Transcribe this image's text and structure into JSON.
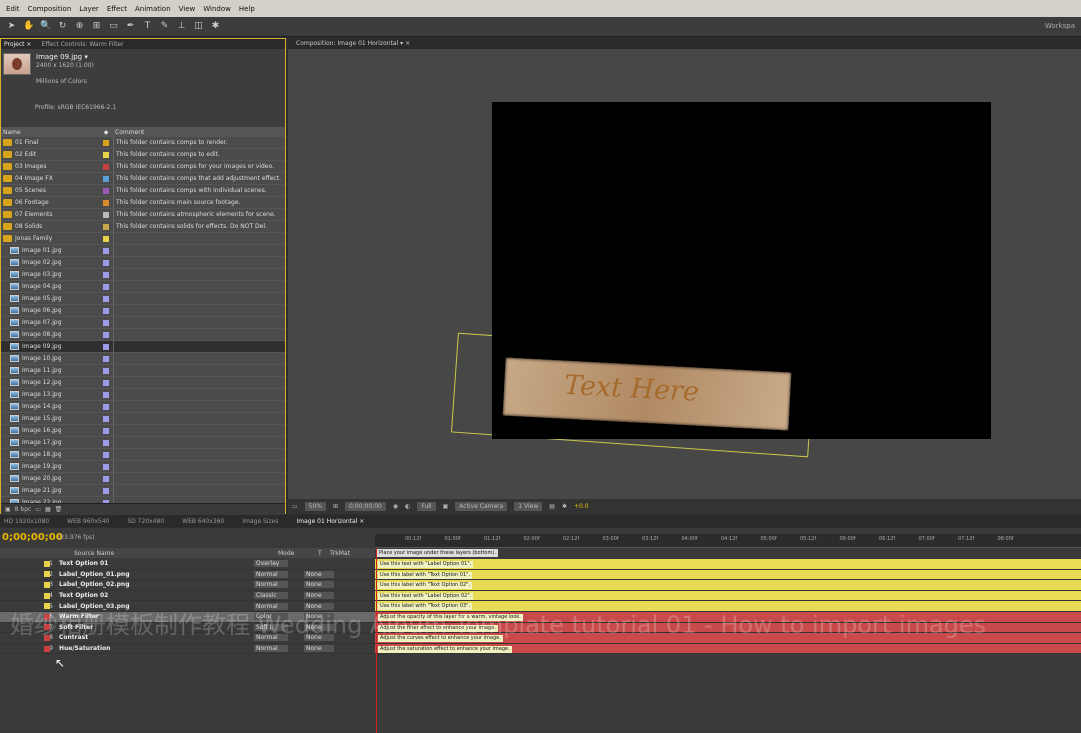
{
  "menu": [
    "Edit",
    "Composition",
    "Layer",
    "Effect",
    "Animation",
    "View",
    "Window",
    "Help"
  ],
  "workspace_label": "Workspa",
  "project": {
    "tabs": [
      "Project ×",
      "Effect Controls: Warm Filter"
    ],
    "selected_name": "Image 09.jpg ▾",
    "dims": "2400 x 1620 (1.00)",
    "colors": "Millions of Colors",
    "profile": "Profile: sRGB IEC61966-2.1",
    "header_name": "Name",
    "header_comment": "Comment",
    "rows": [
      {
        "name": "01 Final",
        "type": "folder",
        "color": "#d9a31c",
        "comment": "This folder contains comps to render."
      },
      {
        "name": "02 Edit",
        "type": "folder",
        "color": "#e7d34a",
        "comment": "This folder contains comps to edit."
      },
      {
        "name": "03 Images",
        "type": "folder",
        "color": "#c94040",
        "comment": "This folder contains comps for your images or video."
      },
      {
        "name": "04 Image FX",
        "type": "folder",
        "color": "#5aa0d8",
        "comment": "This folder contains comps that add adjustment effect."
      },
      {
        "name": "05 Scenes",
        "type": "folder",
        "color": "#9a5ab3",
        "comment": "This folder contains comps with individual scenes."
      },
      {
        "name": "06 Footage",
        "type": "folder",
        "color": "#d98c2a",
        "comment": "This folder contains main source footage."
      },
      {
        "name": "07 Elements",
        "type": "folder",
        "color": "#b8b8b8",
        "comment": "This folder contains atmospheric elements for scene."
      },
      {
        "name": "08 Solids",
        "type": "folder",
        "color": "#c9a64a",
        "comment": "This folder contains solids for effects. Do NOT Del."
      },
      {
        "name": "Jonas Family",
        "type": "folder",
        "color": "#e7d34a",
        "comment": ""
      },
      {
        "name": "Image 01.jpg",
        "type": "image",
        "color": "#9b9be8",
        "comment": ""
      },
      {
        "name": "Image 02.jpg",
        "type": "image",
        "color": "#9b9be8",
        "comment": ""
      },
      {
        "name": "Image 03.jpg",
        "type": "image",
        "color": "#9b9be8",
        "comment": ""
      },
      {
        "name": "Image 04.jpg",
        "type": "image",
        "color": "#9b9be8",
        "comment": ""
      },
      {
        "name": "Image 05.jpg",
        "type": "image",
        "color": "#9b9be8",
        "comment": ""
      },
      {
        "name": "Image 06.jpg",
        "type": "image",
        "color": "#9b9be8",
        "comment": ""
      },
      {
        "name": "Image 07.jpg",
        "type": "image",
        "color": "#9b9be8",
        "comment": ""
      },
      {
        "name": "Image 08.jpg",
        "type": "image",
        "color": "#9b9be8",
        "comment": ""
      },
      {
        "name": "Image 09.jpg",
        "type": "image",
        "color": "#9b9be8",
        "comment": "",
        "selected": true
      },
      {
        "name": "Image 10.jpg",
        "type": "image",
        "color": "#9b9be8",
        "comment": ""
      },
      {
        "name": "Image 11.jpg",
        "type": "image",
        "color": "#9b9be8",
        "comment": ""
      },
      {
        "name": "Image 12.jpg",
        "type": "image",
        "color": "#9b9be8",
        "comment": ""
      },
      {
        "name": "Image 13.jpg",
        "type": "image",
        "color": "#9b9be8",
        "comment": ""
      },
      {
        "name": "Image 14.jpg",
        "type": "image",
        "color": "#9b9be8",
        "comment": ""
      },
      {
        "name": "Image 15.jpg",
        "type": "image",
        "color": "#9b9be8",
        "comment": ""
      },
      {
        "name": "Image 16.jpg",
        "type": "image",
        "color": "#9b9be8",
        "comment": ""
      },
      {
        "name": "Image 17.jpg",
        "type": "image",
        "color": "#9b9be8",
        "comment": ""
      },
      {
        "name": "Image 18.jpg",
        "type": "image",
        "color": "#9b9be8",
        "comment": ""
      },
      {
        "name": "Image 19.jpg",
        "type": "image",
        "color": "#9b9be8",
        "comment": ""
      },
      {
        "name": "Image 20.jpg",
        "type": "image",
        "color": "#9b9be8",
        "comment": ""
      },
      {
        "name": "Image 21.jpg",
        "type": "image",
        "color": "#9b9be8",
        "comment": ""
      },
      {
        "name": "Image 22.jpg",
        "type": "image",
        "color": "#9b9be8",
        "comment": ""
      }
    ],
    "bpc": "8 bpc"
  },
  "composition": {
    "tab": "Composition: Image 01 Horizontal ▾ ×",
    "text_here": "Text Here",
    "bar": {
      "zoom": "50%",
      "timecode": "0;00;00;00",
      "resolution": "Full",
      "camera": "Active Camera",
      "views": "1 View",
      "exposure": "+0.0"
    }
  },
  "timeline_tabs": [
    "HD 1920x1080",
    "WEB 960x540",
    "SD 720x480",
    "WEB 640x360",
    "Image Sizes",
    "Image 01 Horizontal ×"
  ],
  "timeline": {
    "timecode": "0;00;00;00",
    "fps": "(23.976 fps)",
    "ruler": [
      "00:12f",
      "01:00f",
      "01:12f",
      "02:00f",
      "02:12f",
      "03:00f",
      "03:12f",
      "04:00f",
      "04:12f",
      "05:00f",
      "05:12f",
      "06:00f",
      "06:12f",
      "07:00f",
      "07:12f",
      "08:00f"
    ],
    "col_source": "Source Name",
    "col_mode": "Mode",
    "col_t": "T",
    "col_trkmat": "TrkMat",
    "comment_top": "Place your image under these layers (bottom).",
    "layers": [
      {
        "num": "1",
        "name": "Text Option 01",
        "mode": "Overlay",
        "trk": "",
        "color": "#e7d34a",
        "bar": "#e8dc54",
        "label": "Use this text with \"Label Option 01\"."
      },
      {
        "num": "2",
        "name": "Label_Option_01.png",
        "mode": "Normal",
        "trk": "None",
        "color": "#e7d34a",
        "bar": "#e8dc54",
        "label": "Use this label with \"Text Option 01\"."
      },
      {
        "num": "3",
        "name": "Label_Option_02.png",
        "mode": "Normal",
        "trk": "None",
        "color": "#e7d34a",
        "bar": "#e8dc54",
        "label": "Use this label with \"Text Option 02\"."
      },
      {
        "num": "4",
        "name": "Text Option 02",
        "mode": "Classic",
        "trk": "None",
        "color": "#e7d34a",
        "bar": "#e8dc54",
        "label": "Use this text with \"Label Option 02\"."
      },
      {
        "num": "5",
        "name": "Label_Option_03.png",
        "mode": "Normal",
        "trk": "None",
        "color": "#e7d34a",
        "bar": "#e8dc54",
        "label": "Use this label with \"Text Option 03\"."
      },
      {
        "num": "6",
        "name": "Warm Filter",
        "mode": "Color",
        "trk": "None",
        "color": "#c94040",
        "bar": "#c94a4a",
        "label": "Adjust the opacity of this layer for a warm, vintage look.",
        "selected": true
      },
      {
        "num": "7",
        "name": "Soft Filter",
        "mode": "Soft L",
        "trk": "None",
        "color": "#c94040",
        "bar": "#c94a4a",
        "label": "Adjust the filter effect to enhance your image."
      },
      {
        "num": "8",
        "name": "Contrast",
        "mode": "Normal",
        "trk": "None",
        "color": "#c94040",
        "bar": "#c94a4a",
        "label": "Adjust the curves effect to enhance your image."
      },
      {
        "num": "9",
        "name": "Hue/Saturation",
        "mode": "Normal",
        "trk": "None",
        "color": "#c94040",
        "bar": "#c94a4a",
        "label": "Adjust the saturation effect to enhance your image."
      }
    ]
  },
  "watermark": "婚纱相册模板制作教程 Wedding Album Template tutorial 01 - How to import images"
}
